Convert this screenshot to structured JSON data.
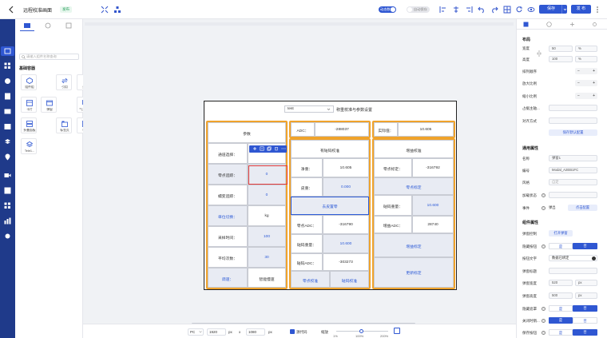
{
  "header": {
    "title": "远程校准画面",
    "publish_badge": "发布",
    "toggle_dynamic": "动态数据",
    "toggle_autosave": "自动保存",
    "save_label": "保存",
    "publish_label": "发 布"
  },
  "palette": {
    "search_placeholder": "请输入组件名称查询",
    "group_title": "基础容器",
    "components": [
      "组件组",
      "引用",
      "迭代",
      "卡片",
      "弹窗",
      "气泡卡片",
      "折叠面板",
      "标签页",
      "栈框",
      "Tele1..."
    ]
  },
  "canvas": {
    "select_value": "test",
    "header_title": "称重校准与参数设置",
    "params": {
      "title": "参数",
      "rows": [
        {
          "label": "通道选择：",
          "value": "1"
        },
        {
          "label": "零点追踪：",
          "value": "0"
        },
        {
          "label": "蠕变追踪：",
          "value": "0"
        },
        {
          "label": "单位切换：",
          "value": "kg"
        },
        {
          "label": "采样时间：",
          "value": "100"
        },
        {
          "label": "平均次数：",
          "value": "30"
        },
        {
          "label": "调速：",
          "value": "智能慢速"
        }
      ]
    },
    "adc": {
      "label": "ADC：",
      "value": "-288037"
    },
    "realtime": {
      "label": "实际值：",
      "value": "10.605"
    },
    "weight_cal": {
      "title": "有砝码校准",
      "net_label": "净重：",
      "net_value": "10.605",
      "tare_label": "皮重：",
      "tare_value": "0.000",
      "tare_button": "去皮置零",
      "zero_adc_label": "零点ADC：",
      "zero_adc_value": "-316790",
      "weight_label": "砝码重量：",
      "weight_value": "10.600",
      "weight_adc_label": "砝码ADC：",
      "weight_adc_value": "-303273",
      "zero_cal_button": "零点校准",
      "weight_cal_button": "砝码校准"
    },
    "gain_cal": {
      "title": "增益校准",
      "zero_cal_label": "零点标定：",
      "zero_cal_value": "-316792",
      "zero_cal_button": "零点标定",
      "weight_label": "砝码重量：",
      "weight_value": "10.600",
      "gain_adc_label": "增益ADC：",
      "gain_adc_value": "28740",
      "gain_cal_button": "增益标定",
      "update_cal_button": "更新标定"
    },
    "toolbar_icons": [
      "add-icon",
      "minus-icon",
      "copy-icon",
      "delete-icon",
      "more-icon"
    ]
  },
  "bottom": {
    "device": "PC",
    "width": "1920",
    "px1": "px",
    "x": "x",
    "height": "1080",
    "px2": "px",
    "source_code": "源代码",
    "zoom_label": "缩放",
    "zoom_min": "1%",
    "zoom_mid": "100%",
    "zoom_max": "200%"
  },
  "right_panel": {
    "layout_title": "布局",
    "width_label": "宽度",
    "width_value": "50",
    "width_unit": "%",
    "height_label": "高度",
    "height_value": "100",
    "height_unit": "%",
    "flex_order_label": "排列顺序",
    "grow_label": "放大比例",
    "shrink_label": "缩小比例",
    "basis_label": "占据主轴...",
    "align_label": "对齐方式",
    "save_default": "保存默认配置",
    "general_title": "通用属性",
    "name_label": "名称",
    "name_value": "弹窗1",
    "id_label": "编号",
    "id_value": "Modal_A2EB1FC",
    "style_label": "风格",
    "style_value": "自定",
    "load_label": "加载状态",
    "event_label": "事件",
    "popup_label": "弹出",
    "click_config": "点击配置",
    "component_title": "组件属性",
    "popup_ctrl_label": "弹窗控制",
    "open_popup": "打开弹窗",
    "hide_header_label": "隐藏按钮",
    "no": "否",
    "yes": "否",
    "footer_text_label": "按钮文字",
    "footer_text_value": "数据已绑定",
    "popup_title_label": "弹窗标题",
    "popup_width_label": "弹窗宽度",
    "popup_width_value": "520",
    "popup_width_unit": "px",
    "popup_height_label": "弹窗高度",
    "popup_height_value": "500",
    "popup_height_unit": "px",
    "hide_mask_label": "隐藏遮罩",
    "close_label": "关闭时销...",
    "save_state_label": "保存按钮",
    "seg_yes": "是",
    "seg_no": "否"
  },
  "colors": {
    "rail": "#1f3a8a",
    "primary": "#2f57d2",
    "accent_orange": "#f0a32b",
    "cell_gray": "#e8ebf3"
  }
}
